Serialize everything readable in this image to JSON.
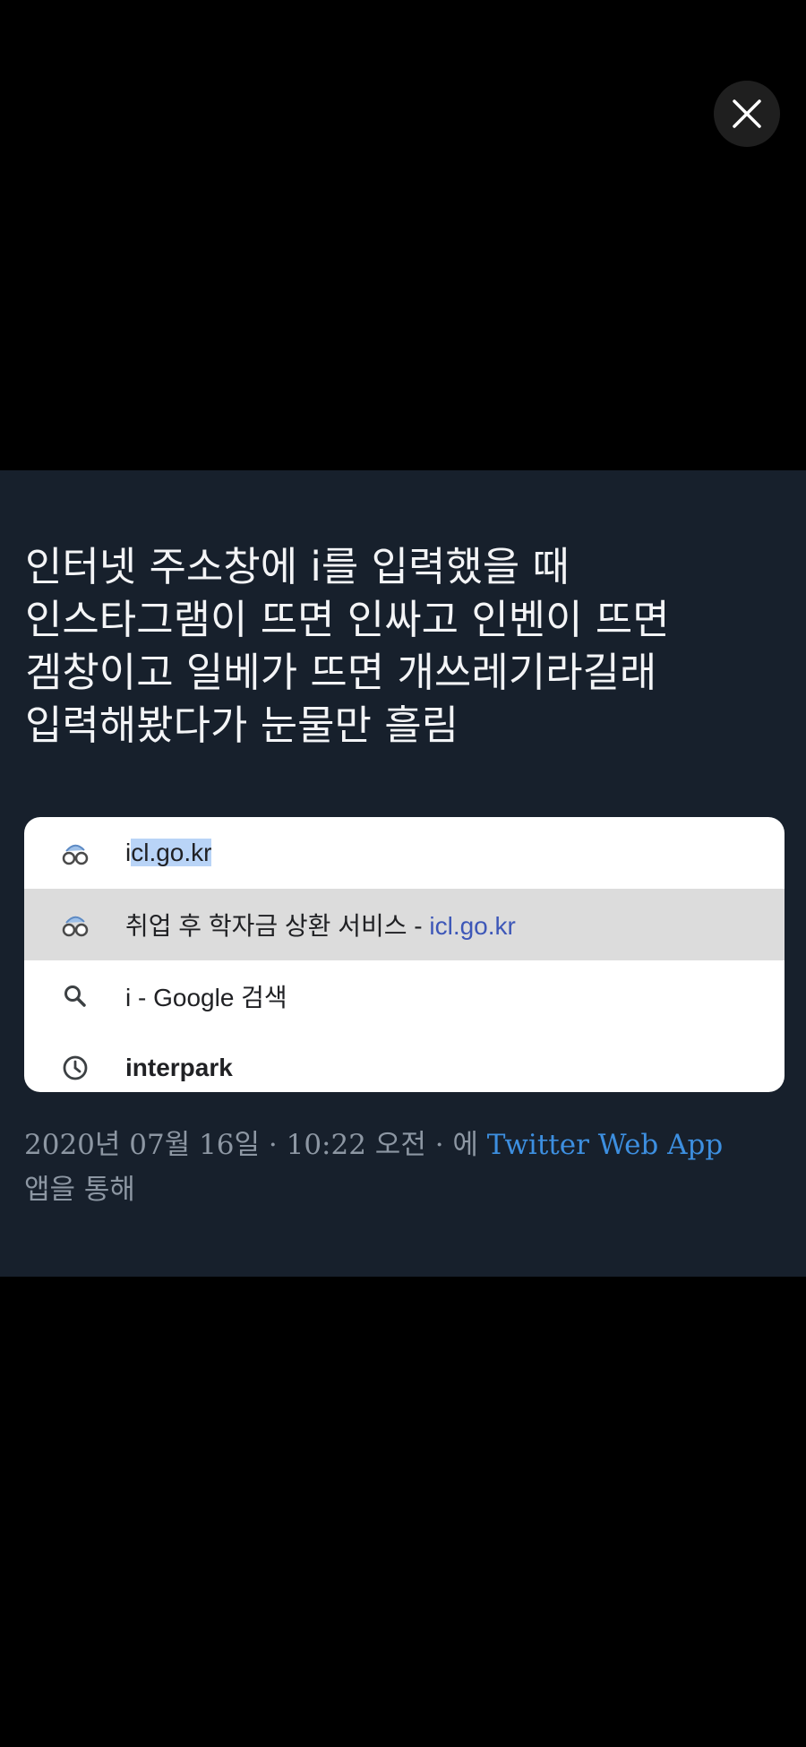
{
  "tweet": {
    "lines": [
      "인터넷 주소창에 i를 입력했을 때",
      "인스타그램이 뜨면 인싸고 인벤이 뜨면",
      "겜창이고 일베가 뜨면 개쓰레기라길래",
      "입력해봤다가 눈물만 흘림"
    ]
  },
  "suggestions": {
    "row1": {
      "prefix": "i",
      "highlight": "cl.go.kr",
      "icon": "site-favicon-icon"
    },
    "row2": {
      "title": "취업 후 학자금 상환 서비스",
      "sep": " - ",
      "url": "icl.go.kr",
      "icon": "site-favicon-icon"
    },
    "row3": {
      "text": "i - Google 검색",
      "icon": "search-icon"
    },
    "row4": {
      "text": "interpark",
      "icon": "history-clock-icon"
    }
  },
  "meta": {
    "timestamp": "2020년 07월 16일 · 10:22 오전 · 에",
    "source": "Twitter Web App",
    "suffix": "앱을 통해"
  },
  "colors": {
    "panel_bg": "#17202c",
    "link": "#3d8fe0",
    "url": "#3d57b8"
  }
}
